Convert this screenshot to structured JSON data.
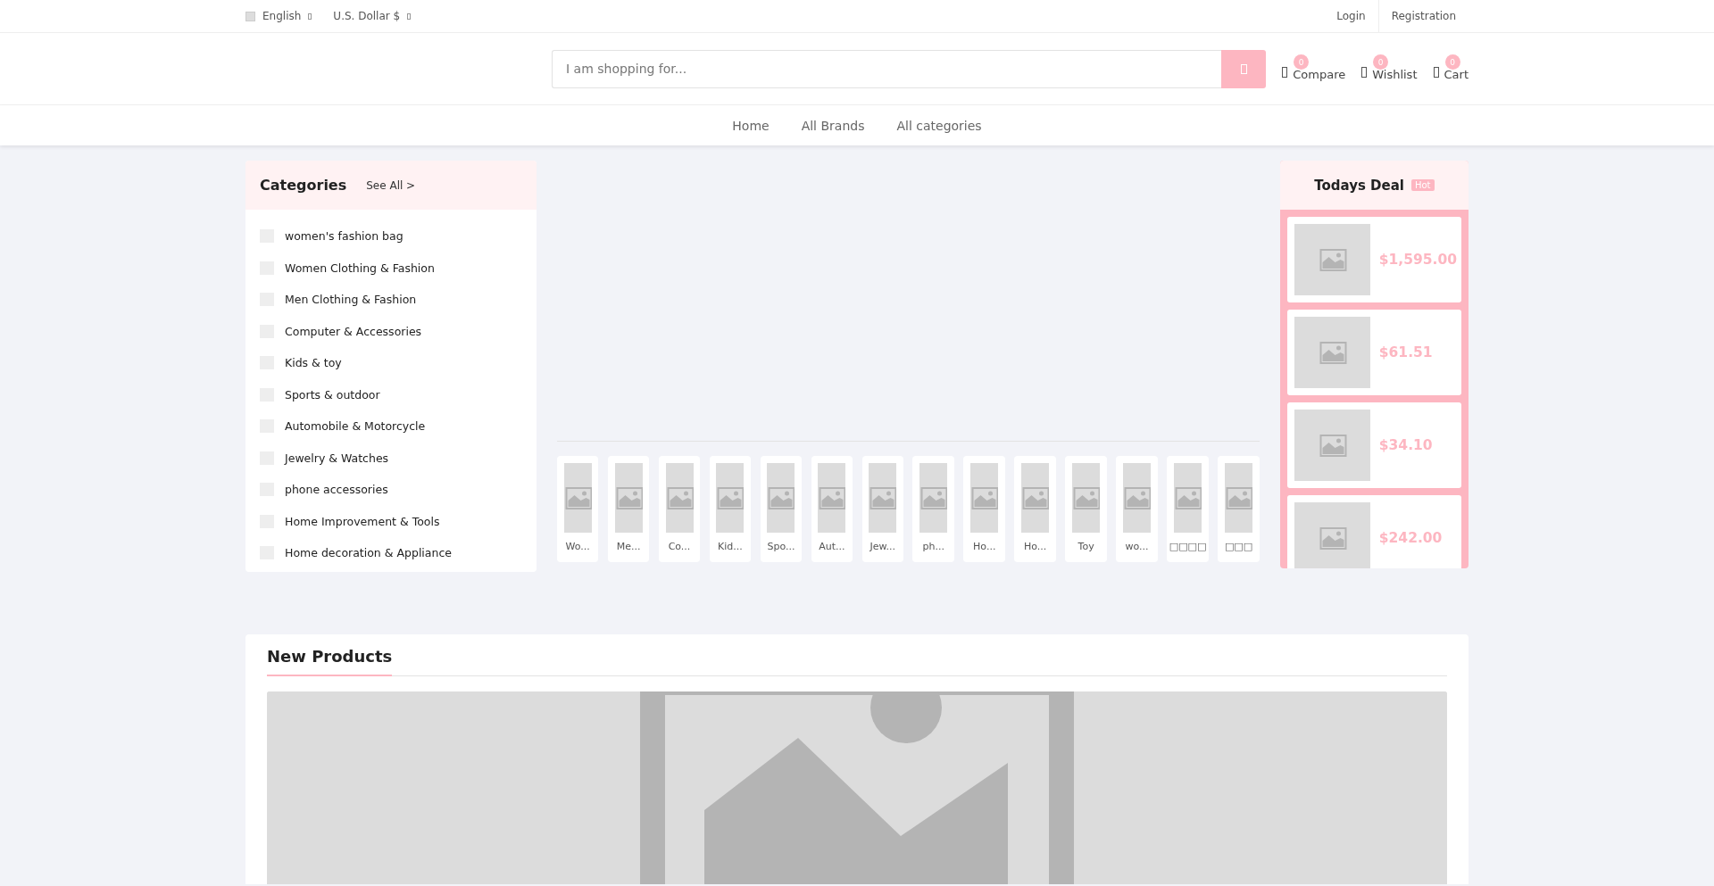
{
  "top_bar": {
    "language": "English",
    "currency": "U.S. Dollar $",
    "links": [
      "Login",
      "Registration"
    ]
  },
  "header": {
    "search": {
      "placeholder": "I am shopping for..."
    },
    "actions": [
      {
        "label": "Compare",
        "count": "0"
      },
      {
        "label": "Wishlist",
        "count": "0"
      },
      {
        "label": "Cart",
        "count": "0"
      }
    ]
  },
  "nav": [
    "Home",
    "All Brands",
    "All categories"
  ],
  "categories": {
    "title": "Categories",
    "see_all": "See All >",
    "items": [
      "women's fashion bag",
      "Women Clothing & Fashion",
      "Men Clothing & Fashion",
      "Computer & Accessories",
      "Kids & toy",
      "Sports & outdoor",
      "Automobile & Motorcycle",
      "Jewelry & Watches",
      "phone accessories",
      "Home Improvement & Tools",
      "Home decoration & Appliance"
    ]
  },
  "featured_categories": [
    "Wo...",
    "Me...",
    "Co...",
    "Kid...",
    "Spo...",
    "Aut...",
    "Jew...",
    "ph...",
    "Ho...",
    "Ho...",
    "Toy",
    "wo...",
    "□□□□",
    "□□□"
  ],
  "todays_deal": {
    "title": "Todays Deal",
    "badge": "Hot",
    "prices": [
      "$1,595.00",
      "$61.51",
      "$34.10",
      "$242.00"
    ]
  },
  "new_products": {
    "title": "New Products"
  }
}
